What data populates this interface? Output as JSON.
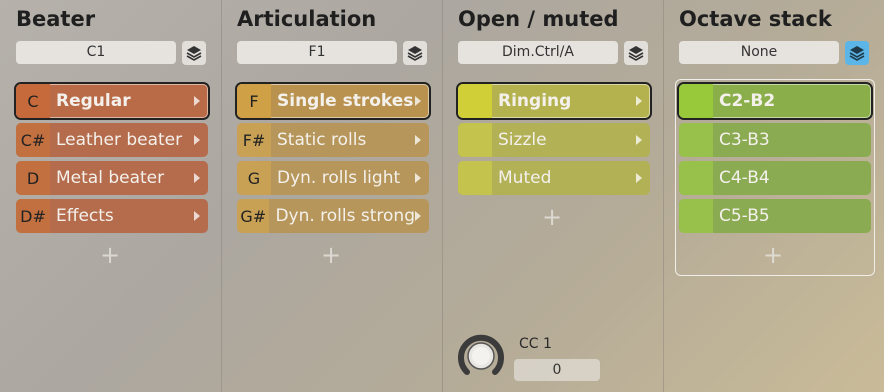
{
  "colors": {
    "beater": [
      "#c76a3b",
      "#b86a48",
      "#b86a48",
      "#b86a48"
    ],
    "articulation": [
      "#c79a43",
      "#bb9653",
      "#bb9653",
      "#bb9653"
    ],
    "open_muted": [
      "#c3c33b",
      "#b8b751",
      "#b8b751"
    ],
    "octave": [
      "#95c13d",
      "#8bb54a",
      "#8bb54a",
      "#8bb54a"
    ],
    "stack_active": "#5bb5e6"
  },
  "columns": [
    {
      "title": "Beater",
      "selector": "C1",
      "items": [
        {
          "key": "C",
          "label": "Regular",
          "selected": true
        },
        {
          "key": "C#",
          "label": "Leather beater",
          "selected": false
        },
        {
          "key": "D",
          "label": "Metal beater",
          "selected": false
        },
        {
          "key": "D#",
          "label": "Effects",
          "selected": false
        }
      ],
      "add": "+"
    },
    {
      "title": "Articulation",
      "selector": "F1",
      "items": [
        {
          "key": "F",
          "label": "Single strokes",
          "selected": true
        },
        {
          "key": "F#",
          "label": "Static rolls",
          "selected": false
        },
        {
          "key": "G",
          "label": "Dyn. rolls light",
          "selected": false
        },
        {
          "key": "G#",
          "label": "Dyn. rolls strong",
          "selected": false
        }
      ],
      "add": "+"
    },
    {
      "title": "Open / muted",
      "selector": "Dim.Ctrl/A",
      "items": [
        {
          "key": "",
          "label": "Ringing",
          "selected": true
        },
        {
          "key": "",
          "label": "Sizzle",
          "selected": false
        },
        {
          "key": "",
          "label": "Muted",
          "selected": false
        }
      ],
      "add": "+",
      "cc_label": "CC 1",
      "cc_value": "0"
    },
    {
      "title": "Octave stack",
      "selector": "None",
      "items": [
        {
          "key": "",
          "label": "C2-B2",
          "selected": true
        },
        {
          "key": "",
          "label": "C3-B3",
          "selected": false
        },
        {
          "key": "",
          "label": "C4-B4",
          "selected": false
        },
        {
          "key": "",
          "label": "C5-B5",
          "selected": false
        }
      ],
      "add": "+"
    }
  ]
}
